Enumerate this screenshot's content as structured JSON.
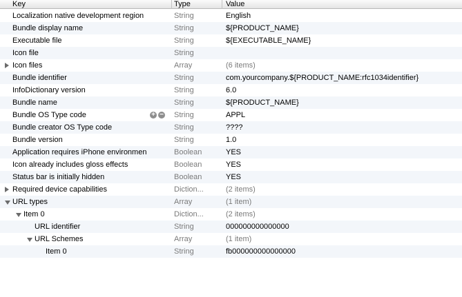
{
  "columns": {
    "key": "Key",
    "type": "Type",
    "value": "Value"
  },
  "rows": [
    {
      "key": "Localization native development region",
      "type": "String",
      "value": "English",
      "indent": 0,
      "disclosure": "none",
      "value_grey": false
    },
    {
      "key": "Bundle display name",
      "type": "String",
      "value": "${PRODUCT_NAME}",
      "indent": 0,
      "disclosure": "none",
      "value_grey": false
    },
    {
      "key": "Executable file",
      "type": "String",
      "value": "${EXECUTABLE_NAME}",
      "indent": 0,
      "disclosure": "none",
      "value_grey": false
    },
    {
      "key": "Icon file",
      "type": "String",
      "value": "",
      "indent": 0,
      "disclosure": "none",
      "value_grey": false
    },
    {
      "key": "Icon files",
      "type": "Array",
      "value": "(6 items)",
      "indent": 0,
      "disclosure": "closed",
      "value_grey": true
    },
    {
      "key": "Bundle identifier",
      "type": "String",
      "value": "com.yourcompany.${PRODUCT_NAME:rfc1034identifier}",
      "indent": 0,
      "disclosure": "none",
      "value_grey": false
    },
    {
      "key": "InfoDictionary version",
      "type": "String",
      "value": "6.0",
      "indent": 0,
      "disclosure": "none",
      "value_grey": false
    },
    {
      "key": "Bundle name",
      "type": "String",
      "value": "${PRODUCT_NAME}",
      "indent": 0,
      "disclosure": "none",
      "value_grey": false
    },
    {
      "key": "Bundle OS Type code",
      "type": "String",
      "value": "APPL",
      "indent": 0,
      "disclosure": "none",
      "value_grey": false,
      "add_remove": true
    },
    {
      "key": "Bundle creator OS Type code",
      "type": "String",
      "value": "????",
      "indent": 0,
      "disclosure": "none",
      "value_grey": false
    },
    {
      "key": "Bundle version",
      "type": "String",
      "value": "1.0",
      "indent": 0,
      "disclosure": "none",
      "value_grey": false
    },
    {
      "key": "Application requires iPhone environmen",
      "type": "Boolean",
      "value": "YES",
      "indent": 0,
      "disclosure": "none",
      "value_grey": false
    },
    {
      "key": "Icon already includes gloss effects",
      "type": "Boolean",
      "value": "YES",
      "indent": 0,
      "disclosure": "none",
      "value_grey": false
    },
    {
      "key": "Status bar is initially hidden",
      "type": "Boolean",
      "value": "YES",
      "indent": 0,
      "disclosure": "none",
      "value_grey": false
    },
    {
      "key": "Required device capabilities",
      "type": "Diction...",
      "value": "(2 items)",
      "indent": 0,
      "disclosure": "closed",
      "value_grey": true
    },
    {
      "key": "URL types",
      "type": "Array",
      "value": "(1 item)",
      "indent": 0,
      "disclosure": "open",
      "value_grey": true
    },
    {
      "key": "Item 0",
      "type": "Diction...",
      "value": "(2 items)",
      "indent": 1,
      "disclosure": "open",
      "value_grey": true
    },
    {
      "key": "URL identifier",
      "type": "String",
      "value": "000000000000000",
      "indent": 2,
      "disclosure": "none",
      "value_grey": false
    },
    {
      "key": "URL Schemes",
      "type": "Array",
      "value": "(1 item)",
      "indent": 2,
      "disclosure": "open",
      "value_grey": true
    },
    {
      "key": "Item 0",
      "type": "String",
      "value": "fb000000000000000",
      "indent": 3,
      "disclosure": "none",
      "value_grey": false
    }
  ],
  "icons": {
    "expand": "disclosure-triangle-icon",
    "add": "plus-circle-icon",
    "remove": "minus-circle-icon"
  }
}
